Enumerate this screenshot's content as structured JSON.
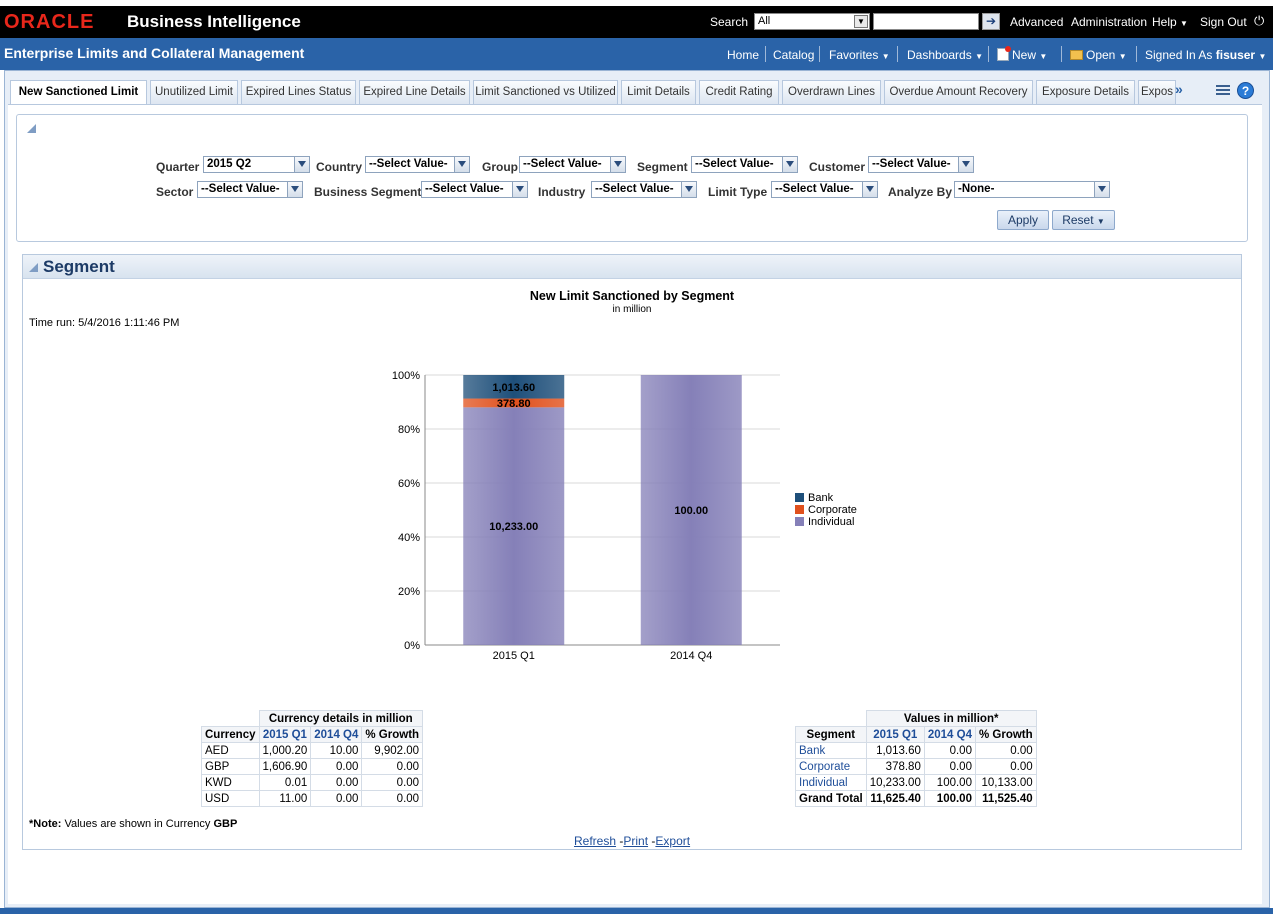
{
  "topbar": {
    "logo": "ORACLE",
    "product": "Business Intelligence",
    "search_label": "Search",
    "search_scope": "All",
    "links": [
      "Advanced",
      "Administration",
      "Help",
      "Sign Out"
    ]
  },
  "header": {
    "title": "Enterprise Limits and Collateral Management",
    "nav": {
      "home": "Home",
      "catalog": "Catalog",
      "favorites": "Favorites",
      "dashboards": "Dashboards",
      "new": "New",
      "open": "Open",
      "signed_in_label": "Signed In As",
      "user": "fisuser"
    }
  },
  "tabs": [
    "New Sanctioned Limit",
    "Unutilized Limit",
    "Expired Lines Status",
    "Expired Line Details",
    "Limit Sanctioned vs Utilized",
    "Limit Details",
    "Credit Rating",
    "Overdrawn Lines",
    "Overdue Amount Recovery",
    "Exposure Details",
    "Expos"
  ],
  "tab_more": "»",
  "prompts": {
    "quarter": {
      "label": "Quarter",
      "value": "2015 Q2"
    },
    "country": {
      "label": "Country",
      "value": "--Select Value-"
    },
    "group": {
      "label": "Group",
      "value": "--Select Value-"
    },
    "segment": {
      "label": "Segment",
      "value": "--Select Value-"
    },
    "customer": {
      "label": "Customer",
      "value": "--Select Value-"
    },
    "sector": {
      "label": "Sector",
      "value": "--Select Value-"
    },
    "business_segment": {
      "label": "Business Segment",
      "value": "--Select Value-"
    },
    "industry": {
      "label": "Industry",
      "value": "--Select Value-"
    },
    "limit_type": {
      "label": "Limit Type",
      "value": "--Select Value-"
    },
    "analyze_by": {
      "label": "Analyze By",
      "value": "-None-"
    },
    "apply": "Apply",
    "reset": "Reset"
  },
  "section": {
    "title": "Segment",
    "time_run_label": "Time run:",
    "time_run_value": "5/4/2016 1:11:46 PM"
  },
  "colors": {
    "bank": "#1e4f7a",
    "corporate": "#e0501c",
    "individual": "#8580b8",
    "header_blue": "#2a63a8"
  },
  "chart_data": {
    "type": "bar",
    "stacked": true,
    "percent_stacked": true,
    "title": "New Limit Sanctioned by Segment",
    "subtitle": "in million",
    "categories": [
      "2015 Q1",
      "2014 Q4"
    ],
    "series": [
      {
        "name": "Bank",
        "values": [
          1013.6,
          0
        ],
        "labels": [
          "1,013.60",
          ""
        ]
      },
      {
        "name": "Corporate",
        "values": [
          378.8,
          0
        ],
        "labels": [
          "378.80",
          ""
        ]
      },
      {
        "name": "Individual",
        "values": [
          10233.0,
          100.0
        ],
        "labels": [
          "10,233.00",
          "100.00"
        ]
      }
    ],
    "yticks": [
      "0%",
      "20%",
      "40%",
      "60%",
      "80%",
      "100%"
    ],
    "ylim": [
      0,
      100
    ],
    "grid": true,
    "legend": "right"
  },
  "currency_table": {
    "caption": "Currency details in million",
    "headers": [
      "Currency",
      "2015 Q1",
      "2014 Q4",
      "% Growth"
    ],
    "rows": [
      [
        "AED",
        "1,000.20",
        "10.00",
        "9,902.00"
      ],
      [
        "GBP",
        "1,606.90",
        "0.00",
        "0.00"
      ],
      [
        "KWD",
        "0.01",
        "0.00",
        "0.00"
      ],
      [
        "USD",
        "11.00",
        "0.00",
        "0.00"
      ]
    ]
  },
  "segment_table": {
    "caption": "Values in million*",
    "headers": [
      "Segment",
      "2015 Q1",
      "2014 Q4",
      "% Growth"
    ],
    "rows": [
      [
        "Bank",
        "1,013.60",
        "0.00",
        "0.00"
      ],
      [
        "Corporate",
        "378.80",
        "0.00",
        "0.00"
      ],
      [
        "Individual",
        "10,233.00",
        "100.00",
        "10,133.00"
      ]
    ],
    "total": [
      "Grand Total",
      "11,625.40",
      "100.00",
      "11,525.40"
    ]
  },
  "note": {
    "label": "*Note:",
    "text": "Values are shown in Currency",
    "currency": "GBP"
  },
  "footer": {
    "refresh": "Refresh",
    "print": "Print",
    "export": "Export"
  }
}
